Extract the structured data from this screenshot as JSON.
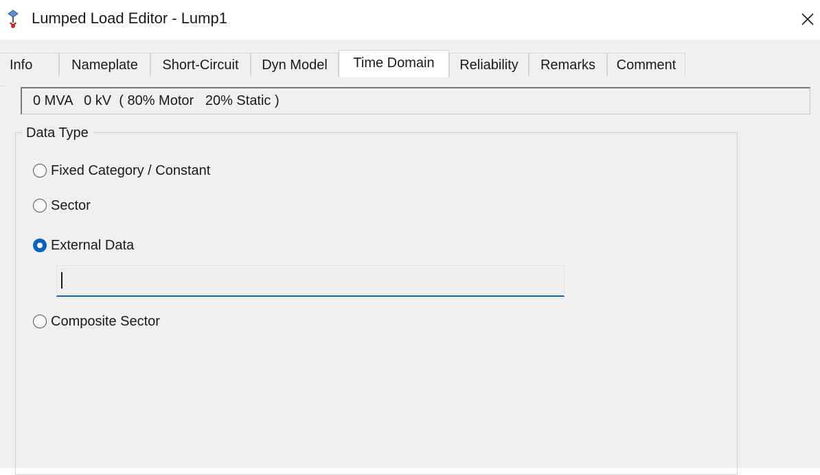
{
  "window": {
    "title": "Lumped Load Editor - Lump1",
    "app_icon": "lumped-load-icon",
    "close_icon": "close-icon"
  },
  "tabs": [
    {
      "label": "Info",
      "active": false
    },
    {
      "label": "Nameplate",
      "active": false
    },
    {
      "label": "Short-Circuit",
      "active": false
    },
    {
      "label": "Dyn Model",
      "active": false
    },
    {
      "label": "Time Domain",
      "active": true
    },
    {
      "label": "Reliability",
      "active": false
    },
    {
      "label": "Remarks",
      "active": false
    },
    {
      "label": "Comment",
      "active": false
    }
  ],
  "summary": "0 MVA   0 kV  ( 80% Motor   20% Static )",
  "data_type": {
    "group_label": "Data Type",
    "options": [
      {
        "label": "Fixed Category / Constant",
        "checked": false
      },
      {
        "label": "Sector",
        "checked": false
      },
      {
        "label": "External Data",
        "checked": true
      },
      {
        "label": "Composite Sector",
        "checked": false
      }
    ],
    "external_data_value": ""
  },
  "colors": {
    "accent": "#0a62c0",
    "panel_bg": "#f0f0f0",
    "titlebar_bg": "#ffffff"
  }
}
